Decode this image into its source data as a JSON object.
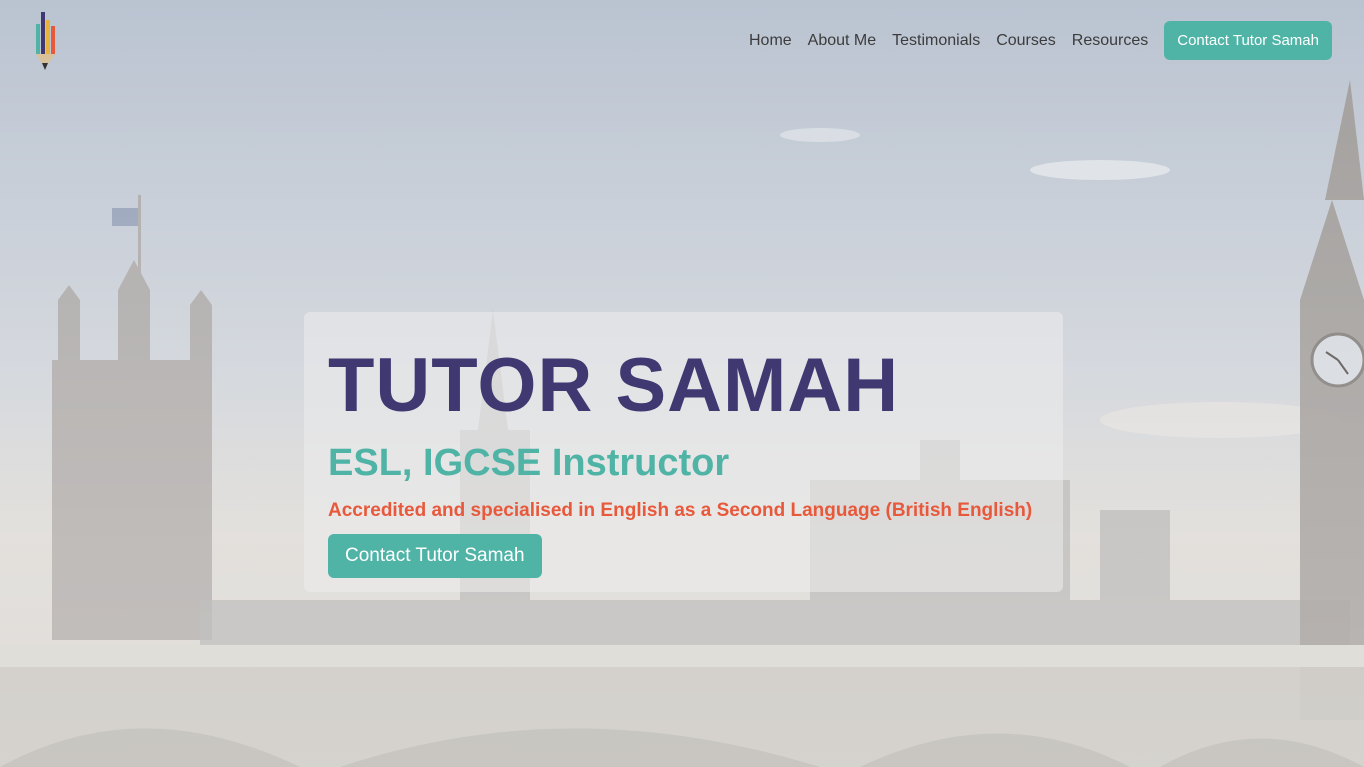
{
  "nav": {
    "logo_icon": "pencil-logo-icon",
    "links": [
      "Home",
      "About Me",
      "Testimonials",
      "Courses",
      "Resources"
    ],
    "cta_label": "Contact Tutor Samah"
  },
  "hero": {
    "title": "TUTOR SAMAH",
    "subtitle": "ESL, IGCSE Instructor",
    "tagline": "Accredited and specialised in English as a Second Language (British English)",
    "cta_label": "Contact Tutor Samah"
  },
  "background": {
    "scene": "london-westminster-skyline-image"
  },
  "colors": {
    "primary": "#3f3871",
    "accent": "#4fb3a6",
    "highlight": "#e8593c"
  }
}
